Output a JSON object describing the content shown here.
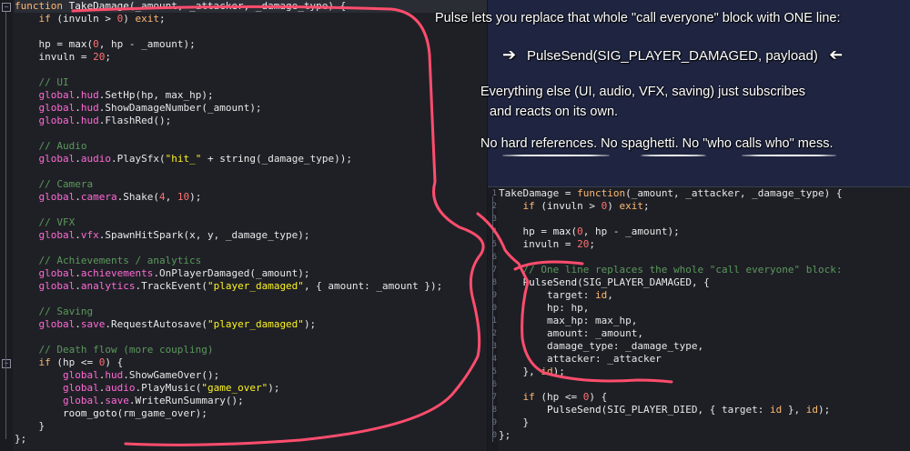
{
  "left_code": {
    "lines": [
      [
        [
          "kw",
          "function "
        ],
        [
          "fn",
          "TakeDamage"
        ],
        [
          "ident",
          "(_amount, _attacker, _damage_type) {"
        ]
      ],
      [
        [
          "ident",
          "    "
        ],
        [
          "kw",
          "if"
        ],
        [
          "ident",
          " (invuln > "
        ],
        [
          "num",
          "0"
        ],
        [
          "ident",
          ") "
        ],
        [
          "kw",
          "exit"
        ],
        [
          "ident",
          ";"
        ]
      ],
      [
        [
          "ident",
          ""
        ]
      ],
      [
        [
          "ident",
          "    hp = "
        ],
        [
          "fn",
          "max"
        ],
        [
          "ident",
          "("
        ],
        [
          "num",
          "0"
        ],
        [
          "ident",
          ", hp - _amount);"
        ]
      ],
      [
        [
          "ident",
          "    invuln = "
        ],
        [
          "num",
          "20"
        ],
        [
          "ident",
          ";"
        ]
      ],
      [
        [
          "ident",
          ""
        ]
      ],
      [
        [
          "cm",
          "    // UI"
        ]
      ],
      [
        [
          "ident",
          "    "
        ],
        [
          "gv",
          "global"
        ],
        [
          "ident",
          "."
        ],
        [
          "gv",
          "hud"
        ],
        [
          "ident",
          ".SetHp(hp, max_hp);"
        ]
      ],
      [
        [
          "ident",
          "    "
        ],
        [
          "gv",
          "global"
        ],
        [
          "ident",
          "."
        ],
        [
          "gv",
          "hud"
        ],
        [
          "ident",
          ".ShowDamageNumber(_amount);"
        ]
      ],
      [
        [
          "ident",
          "    "
        ],
        [
          "gv",
          "global"
        ],
        [
          "ident",
          "."
        ],
        [
          "gv",
          "hud"
        ],
        [
          "ident",
          ".FlashRed();"
        ]
      ],
      [
        [
          "ident",
          ""
        ]
      ],
      [
        [
          "cm",
          "    // Audio"
        ]
      ],
      [
        [
          "ident",
          "    "
        ],
        [
          "gv",
          "global"
        ],
        [
          "ident",
          "."
        ],
        [
          "gv",
          "audio"
        ],
        [
          "ident",
          ".PlaySfx("
        ],
        [
          "str",
          "\"hit_\""
        ],
        [
          "ident",
          " + "
        ],
        [
          "fn",
          "string"
        ],
        [
          "ident",
          "(_damage_type));"
        ]
      ],
      [
        [
          "ident",
          ""
        ]
      ],
      [
        [
          "cm",
          "    // Camera"
        ]
      ],
      [
        [
          "ident",
          "    "
        ],
        [
          "gv",
          "global"
        ],
        [
          "ident",
          "."
        ],
        [
          "gv",
          "camera"
        ],
        [
          "ident",
          ".Shake("
        ],
        [
          "num",
          "4"
        ],
        [
          "ident",
          ", "
        ],
        [
          "num",
          "10"
        ],
        [
          "ident",
          ");"
        ]
      ],
      [
        [
          "ident",
          ""
        ]
      ],
      [
        [
          "cm",
          "    // VFX"
        ]
      ],
      [
        [
          "ident",
          "    "
        ],
        [
          "gv",
          "global"
        ],
        [
          "ident",
          "."
        ],
        [
          "gv",
          "vfx"
        ],
        [
          "ident",
          ".SpawnHitSpark(x, y, _damage_type);"
        ]
      ],
      [
        [
          "ident",
          ""
        ]
      ],
      [
        [
          "cm",
          "    // Achievements / analytics"
        ]
      ],
      [
        [
          "ident",
          "    "
        ],
        [
          "gv",
          "global"
        ],
        [
          "ident",
          "."
        ],
        [
          "gv",
          "achievements"
        ],
        [
          "ident",
          ".OnPlayerDamaged(_amount);"
        ]
      ],
      [
        [
          "ident",
          "    "
        ],
        [
          "gv",
          "global"
        ],
        [
          "ident",
          "."
        ],
        [
          "gv",
          "analytics"
        ],
        [
          "ident",
          ".TrackEvent("
        ],
        [
          "str",
          "\"player_damaged\""
        ],
        [
          "ident",
          ", { amount: _amount });"
        ]
      ],
      [
        [
          "ident",
          ""
        ]
      ],
      [
        [
          "cm",
          "    // Saving"
        ]
      ],
      [
        [
          "ident",
          "    "
        ],
        [
          "gv",
          "global"
        ],
        [
          "ident",
          "."
        ],
        [
          "gv",
          "save"
        ],
        [
          "ident",
          ".RequestAutosave("
        ],
        [
          "str",
          "\"player_damaged\""
        ],
        [
          "ident",
          ");"
        ]
      ],
      [
        [
          "ident",
          ""
        ]
      ],
      [
        [
          "cm",
          "    // Death flow (more coupling)"
        ]
      ],
      [
        [
          "ident",
          "    "
        ],
        [
          "kw",
          "if"
        ],
        [
          "ident",
          " (hp <= "
        ],
        [
          "num",
          "0"
        ],
        [
          "ident",
          ") {"
        ]
      ],
      [
        [
          "ident",
          "        "
        ],
        [
          "gv",
          "global"
        ],
        [
          "ident",
          "."
        ],
        [
          "gv",
          "hud"
        ],
        [
          "ident",
          ".ShowGameOver();"
        ]
      ],
      [
        [
          "ident",
          "        "
        ],
        [
          "gv",
          "global"
        ],
        [
          "ident",
          "."
        ],
        [
          "gv",
          "audio"
        ],
        [
          "ident",
          ".PlayMusic("
        ],
        [
          "str",
          "\"game_over\""
        ],
        [
          "ident",
          ");"
        ]
      ],
      [
        [
          "ident",
          "        "
        ],
        [
          "gv",
          "global"
        ],
        [
          "ident",
          "."
        ],
        [
          "gv",
          "save"
        ],
        [
          "ident",
          ".WriteRunSummary();"
        ]
      ],
      [
        [
          "ident",
          "        "
        ],
        [
          "fn",
          "room_goto"
        ],
        [
          "ident",
          "(rm_game_over);"
        ]
      ],
      [
        [
          "ident",
          "    }"
        ]
      ],
      [
        [
          "ident",
          "};"
        ]
      ]
    ]
  },
  "right_code": {
    "lines": [
      [
        [
          "ident",
          "TakeDamage = "
        ],
        [
          "kw",
          "function"
        ],
        [
          "ident",
          "(_amount, _attacker, _damage_type) {"
        ]
      ],
      [
        [
          "ident",
          "    "
        ],
        [
          "kw",
          "if"
        ],
        [
          "ident",
          " (invuln > "
        ],
        [
          "num",
          "0"
        ],
        [
          "ident",
          ") "
        ],
        [
          "kw",
          "exit"
        ],
        [
          "ident",
          ";"
        ]
      ],
      [
        [
          "ident",
          ""
        ]
      ],
      [
        [
          "ident",
          "    hp = "
        ],
        [
          "fn",
          "max"
        ],
        [
          "ident",
          "("
        ],
        [
          "num",
          "0"
        ],
        [
          "ident",
          ", hp - _amount);"
        ]
      ],
      [
        [
          "ident",
          "    invuln = "
        ],
        [
          "num",
          "20"
        ],
        [
          "ident",
          ";"
        ]
      ],
      [
        [
          "ident",
          ""
        ]
      ],
      [
        [
          "cm",
          "    // One line replaces the whole \"call everyone\" block:"
        ]
      ],
      [
        [
          "ident",
          "    "
        ],
        [
          "fn",
          "PulseSend"
        ],
        [
          "ident",
          "(SIG_PLAYER_DAMAGED, {"
        ]
      ],
      [
        [
          "ident",
          "        target: "
        ],
        [
          "kw",
          "id"
        ],
        [
          "ident",
          ","
        ]
      ],
      [
        [
          "ident",
          "        hp: hp,"
        ]
      ],
      [
        [
          "ident",
          "        max_hp: max_hp,"
        ]
      ],
      [
        [
          "ident",
          "        amount: _amount,"
        ]
      ],
      [
        [
          "ident",
          "        damage_type: _damage_type,"
        ]
      ],
      [
        [
          "ident",
          "        attacker: _attacker"
        ]
      ],
      [
        [
          "ident",
          "    }, "
        ],
        [
          "kw",
          "id"
        ],
        [
          "ident",
          ");"
        ]
      ],
      [
        [
          "ident",
          ""
        ]
      ],
      [
        [
          "ident",
          "    "
        ],
        [
          "kw",
          "if"
        ],
        [
          "ident",
          " (hp <= "
        ],
        [
          "num",
          "0"
        ],
        [
          "ident",
          ") {"
        ]
      ],
      [
        [
          "ident",
          "        "
        ],
        [
          "fn",
          "PulseSend"
        ],
        [
          "ident",
          "(SIG_PLAYER_DIED, { target: "
        ],
        [
          "kw",
          "id"
        ],
        [
          "ident",
          " }, "
        ],
        [
          "kw",
          "id"
        ],
        [
          "ident",
          ");"
        ]
      ],
      [
        [
          "ident",
          "    }"
        ]
      ],
      [
        [
          "ident",
          "};"
        ]
      ]
    ],
    "line_numbers": [
      "1",
      "2",
      "3",
      "4",
      "5",
      "6",
      "7",
      "8",
      "9",
      "0",
      "1",
      "2",
      "3",
      "4",
      "5",
      "6",
      "7",
      "8",
      "9",
      "0"
    ]
  },
  "annotations": {
    "headline": "Pulse lets you replace that whole \"call everyone\" block with ONE line:",
    "code_line": "PulseSend(SIG_PLAYER_DAMAGED, payload)",
    "arrow_left_icon": "arrow-right",
    "arrow_right_icon": "arrow-left",
    "subscribe_line1": "Everything else (UI, audio, VFX, saving) just subscribes",
    "subscribe_line2": "and reacts on its own.",
    "tagline": "No hard references. No spaghetti. No \"who calls who\" mess."
  },
  "colors": {
    "annotation_stroke": "#ff4d6d",
    "keyword": "#ffb871",
    "string": "#fcf320",
    "number": "#ff7070",
    "comment": "#5b995b",
    "global": "#ff6ad5"
  }
}
